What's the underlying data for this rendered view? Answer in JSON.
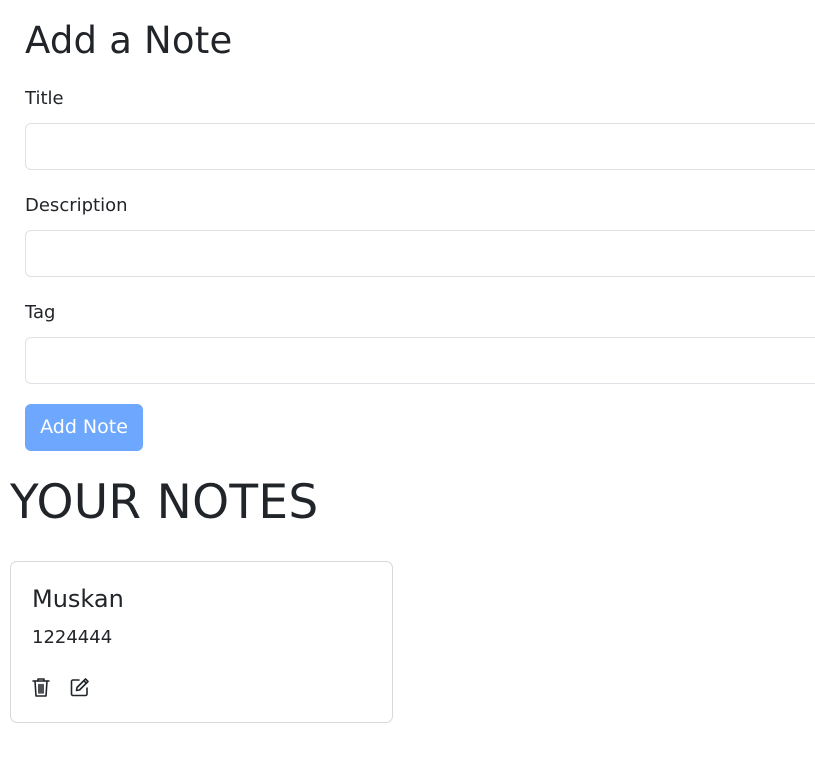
{
  "add_note": {
    "heading": "Add a Note",
    "fields": {
      "title": {
        "label": "Title",
        "value": "",
        "placeholder": ""
      },
      "description": {
        "label": "Description",
        "value": "",
        "placeholder": ""
      },
      "tag": {
        "label": "Tag",
        "value": "",
        "placeholder": ""
      }
    },
    "submit_label": "Add Note",
    "submit_color": "#6ea8fe"
  },
  "notes": {
    "heading": "YOUR NOTES",
    "items": [
      {
        "title": "Muskan",
        "description": "1224444",
        "actions": [
          "trash-icon",
          "edit-icon"
        ]
      }
    ]
  }
}
